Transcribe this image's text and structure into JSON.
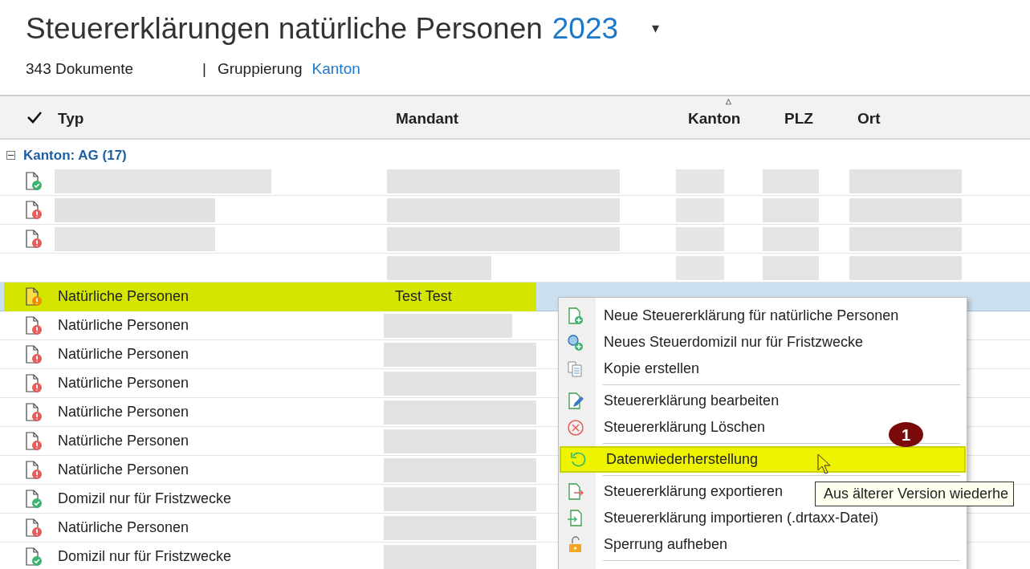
{
  "header": {
    "title": "Steuererklärungen natürliche Personen",
    "year": "2023",
    "caret": "▾",
    "count": "343 Dokumente",
    "divider": "|",
    "grouping_label": "Gruppierung",
    "grouping_value": "Kanton"
  },
  "table": {
    "columns": [
      {
        "label": "Typ"
      },
      {
        "label": "Mandant"
      },
      {
        "label": "Kanton",
        "sort_arrow": "△"
      },
      {
        "label": "PLZ"
      },
      {
        "label": "Ort"
      }
    ],
    "group": {
      "label": "Kanton: AG (17)",
      "expanded": true
    },
    "rows": [
      {
        "kind": "ok",
        "selected": false
      },
      {
        "kind": "error",
        "selected": false
      },
      {
        "kind": "error",
        "selected": false
      },
      {
        "kind": "blank",
        "selected": false
      },
      {
        "kind": "warning",
        "typ": "Natürliche Personen",
        "mandant": "Test Test",
        "selected": true
      },
      {
        "kind": "error",
        "typ": "Natürliche Personen",
        "selected": false
      },
      {
        "kind": "error",
        "typ": "Natürliche Personen",
        "selected": false
      },
      {
        "kind": "error",
        "typ": "Natürliche Personen",
        "selected": false
      },
      {
        "kind": "error",
        "typ": "Natürliche Personen",
        "selected": false
      },
      {
        "kind": "error",
        "typ": "Natürliche Personen",
        "selected": false
      },
      {
        "kind": "error",
        "typ": "Natürliche Personen",
        "selected": false
      },
      {
        "kind": "ok",
        "typ": "Domizil nur für Fristzwecke",
        "selected": false
      },
      {
        "kind": "error",
        "typ": "Natürliche Personen",
        "selected": false
      },
      {
        "kind": "ok",
        "typ": "Domizil nur für Fristzwecke",
        "selected": false
      }
    ]
  },
  "context_menu": {
    "items": [
      {
        "kind": "item",
        "label": "Neue Steuererklärung für natürliche Personen",
        "selected": false
      },
      {
        "kind": "item",
        "label": "Neues Steuerdomizil nur für Fristzwecke",
        "selected": false
      },
      {
        "kind": "item",
        "label": "Kopie erstellen",
        "selected": false
      },
      {
        "kind": "separator"
      },
      {
        "kind": "item",
        "label": "Steuererklärung bearbeiten",
        "selected": false
      },
      {
        "kind": "item",
        "label": "Steuererklärung Löschen",
        "selected": false
      },
      {
        "kind": "separator"
      },
      {
        "kind": "item",
        "label": "Datenwiederherstellung",
        "selected": true
      },
      {
        "kind": "separator"
      },
      {
        "kind": "item",
        "label": "Steuererklärung exportieren",
        "selected": false
      },
      {
        "kind": "item",
        "label": "Steuererklärung importieren (.drtaxx-Datei)",
        "selected": false
      },
      {
        "kind": "item",
        "label": "Sperrung aufheben",
        "selected": false
      },
      {
        "kind": "separator"
      }
    ]
  },
  "tooltip": "Aus älterer Version wiederhe",
  "callout": "1"
}
